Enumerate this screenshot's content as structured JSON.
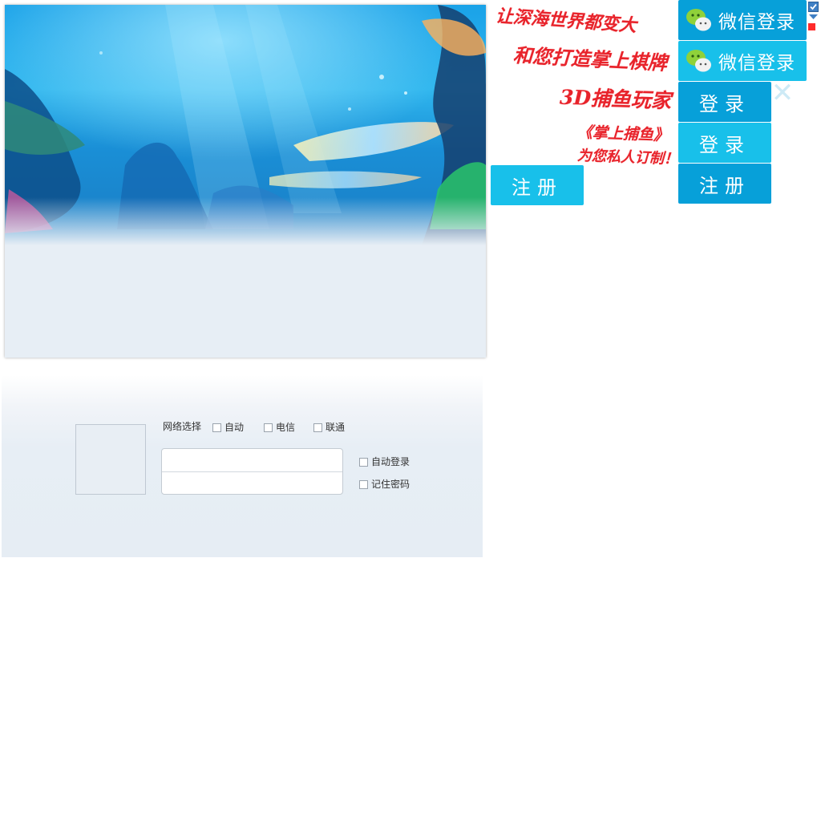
{
  "login_panel": {
    "network_label": "网络选择",
    "network_options": [
      "自动",
      "电信",
      "联通"
    ],
    "auto_login_label": "自动登录",
    "remember_password_label": "记住密码",
    "username_value": "",
    "password_value": ""
  },
  "promo": {
    "line1": "让深海世界都变大",
    "line2": "和您打造掌上棋牌",
    "line3": "3D捕鱼玩家",
    "line4": "《掌上捕鱼》",
    "line5": "为您私人订制！"
  },
  "buttons": {
    "wechat_login_1": "微信登录",
    "wechat_login_2": "微信登录",
    "login_1": "登录",
    "login_2": "登录",
    "register_1": "注册",
    "register_2": "注册"
  },
  "colors": {
    "button_dark": "#07a0d9",
    "button_light": "#18c0ea",
    "promo_red": "#e8232b"
  },
  "icons": {
    "close": "close-icon",
    "wechat": "wechat-icon",
    "checkbox_checked": "checkbox-checked-icon",
    "dropdown_arrow": "chevron-down-icon",
    "red_square": "red-square-icon"
  }
}
